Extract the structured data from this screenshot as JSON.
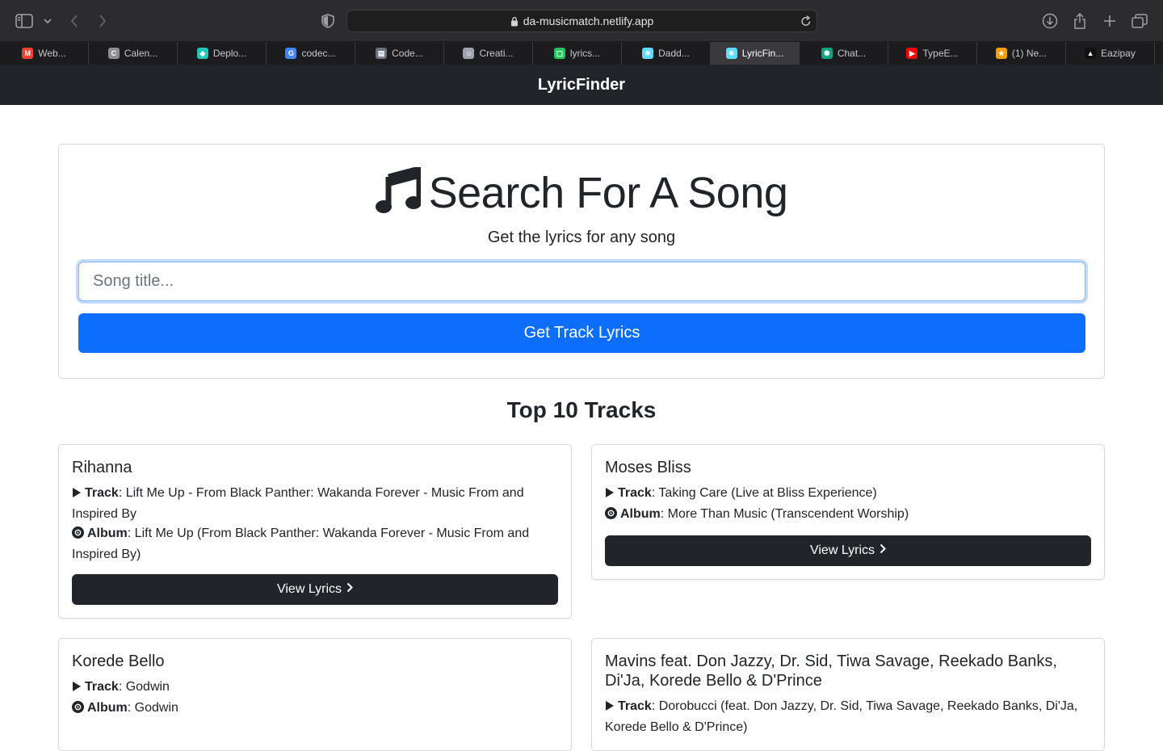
{
  "browser": {
    "url": "da-musicmatch.netlify.app",
    "tabs": [
      {
        "label": "Web...",
        "icon": "gmail-icon",
        "color": "#ea4335"
      },
      {
        "label": "Calen...",
        "icon": "calendar-icon",
        "color": "#8e8e93"
      },
      {
        "label": "Deplo...",
        "icon": "netlify-icon",
        "color": "#20c6b7"
      },
      {
        "label": "codec...",
        "icon": "google-icon",
        "color": "#4285f4"
      },
      {
        "label": "Code...",
        "icon": "document-icon",
        "color": "#6b7280"
      },
      {
        "label": "Creati...",
        "icon": "robot-icon",
        "color": "#9ca3af"
      },
      {
        "label": "lyrics...",
        "icon": "codesandbox-icon",
        "color": "#22c55e"
      },
      {
        "label": "Dadd...",
        "icon": "react-icon",
        "color": "#61dafb"
      },
      {
        "label": "LyricFin...",
        "icon": "react-icon",
        "color": "#61dafb"
      },
      {
        "label": "Chat...",
        "icon": "chatgpt-icon",
        "color": "#10a37f"
      },
      {
        "label": "TypeE...",
        "icon": "youtube-icon",
        "color": "#ff0000"
      },
      {
        "label": "(1) Ne...",
        "icon": "cat-icon",
        "color": "#f59e0b"
      },
      {
        "label": "Eazipay",
        "icon": "eazipay-icon",
        "color": "#111111"
      }
    ],
    "active_tab_index": 8
  },
  "navbar": {
    "brand": "LyricFinder"
  },
  "search": {
    "title": "Search For A Song",
    "subtitle": "Get the lyrics for any song",
    "placeholder": "Song title...",
    "value": "",
    "button_label": "Get Track Lyrics"
  },
  "top_tracks": {
    "title": "Top 10 Tracks",
    "track_label": "Track",
    "album_label": "Album",
    "view_label": "View Lyrics",
    "items": [
      {
        "artist": "Rihanna",
        "track": "Lift Me Up - From Black Panther: Wakanda Forever - Music From and Inspired By",
        "album": "Lift Me Up (From Black Panther: Wakanda Forever - Music From and Inspired By)"
      },
      {
        "artist": "Moses Bliss",
        "track": "Taking Care (Live at Bliss Experience)",
        "album": "More Than Music (Transcendent Worship)"
      },
      {
        "artist": "Korede Bello",
        "track": "Godwin",
        "album": "Godwin"
      },
      {
        "artist": "Mavins feat. Don Jazzy, Dr. Sid, Tiwa Savage, Reekado Banks, Di'Ja, Korede Bello & D'Prince",
        "track": "Dorobucci (feat. Don Jazzy, Dr. Sid, Tiwa Savage, Reekado Banks, Di'Ja, Korede Bello & D'Prince)",
        "album": ""
      }
    ]
  },
  "colors": {
    "primary": "#0d6efd",
    "dark": "#212529",
    "chrome": "#2c2c2e"
  }
}
